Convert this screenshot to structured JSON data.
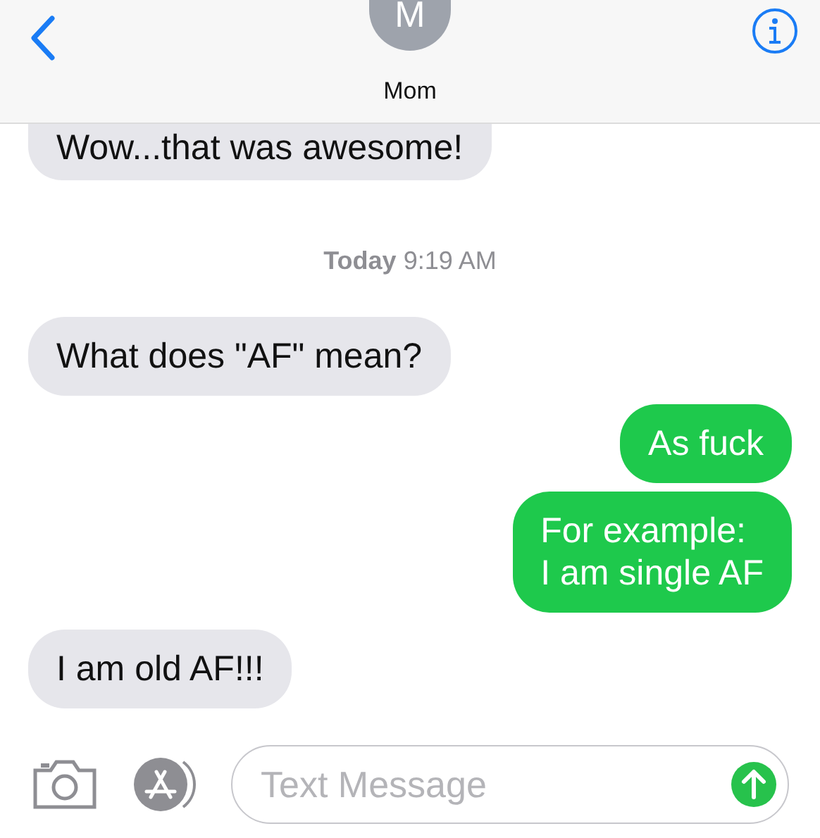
{
  "header": {
    "avatar_initial": "M",
    "contact_name": "Mom"
  },
  "messages": [
    {
      "kind": "received",
      "text": "Wow...that was awesome!"
    },
    {
      "kind": "timestamp",
      "day": "Today",
      "time": "9:19 AM"
    },
    {
      "kind": "received",
      "text": "What does \"AF\" mean?"
    },
    {
      "kind": "sent",
      "text": "As fuck"
    },
    {
      "kind": "sent",
      "text": "For example:\nI am single AF"
    },
    {
      "kind": "received",
      "text": "I am old AF!!!"
    }
  ],
  "composer": {
    "placeholder": "Text Message"
  }
}
